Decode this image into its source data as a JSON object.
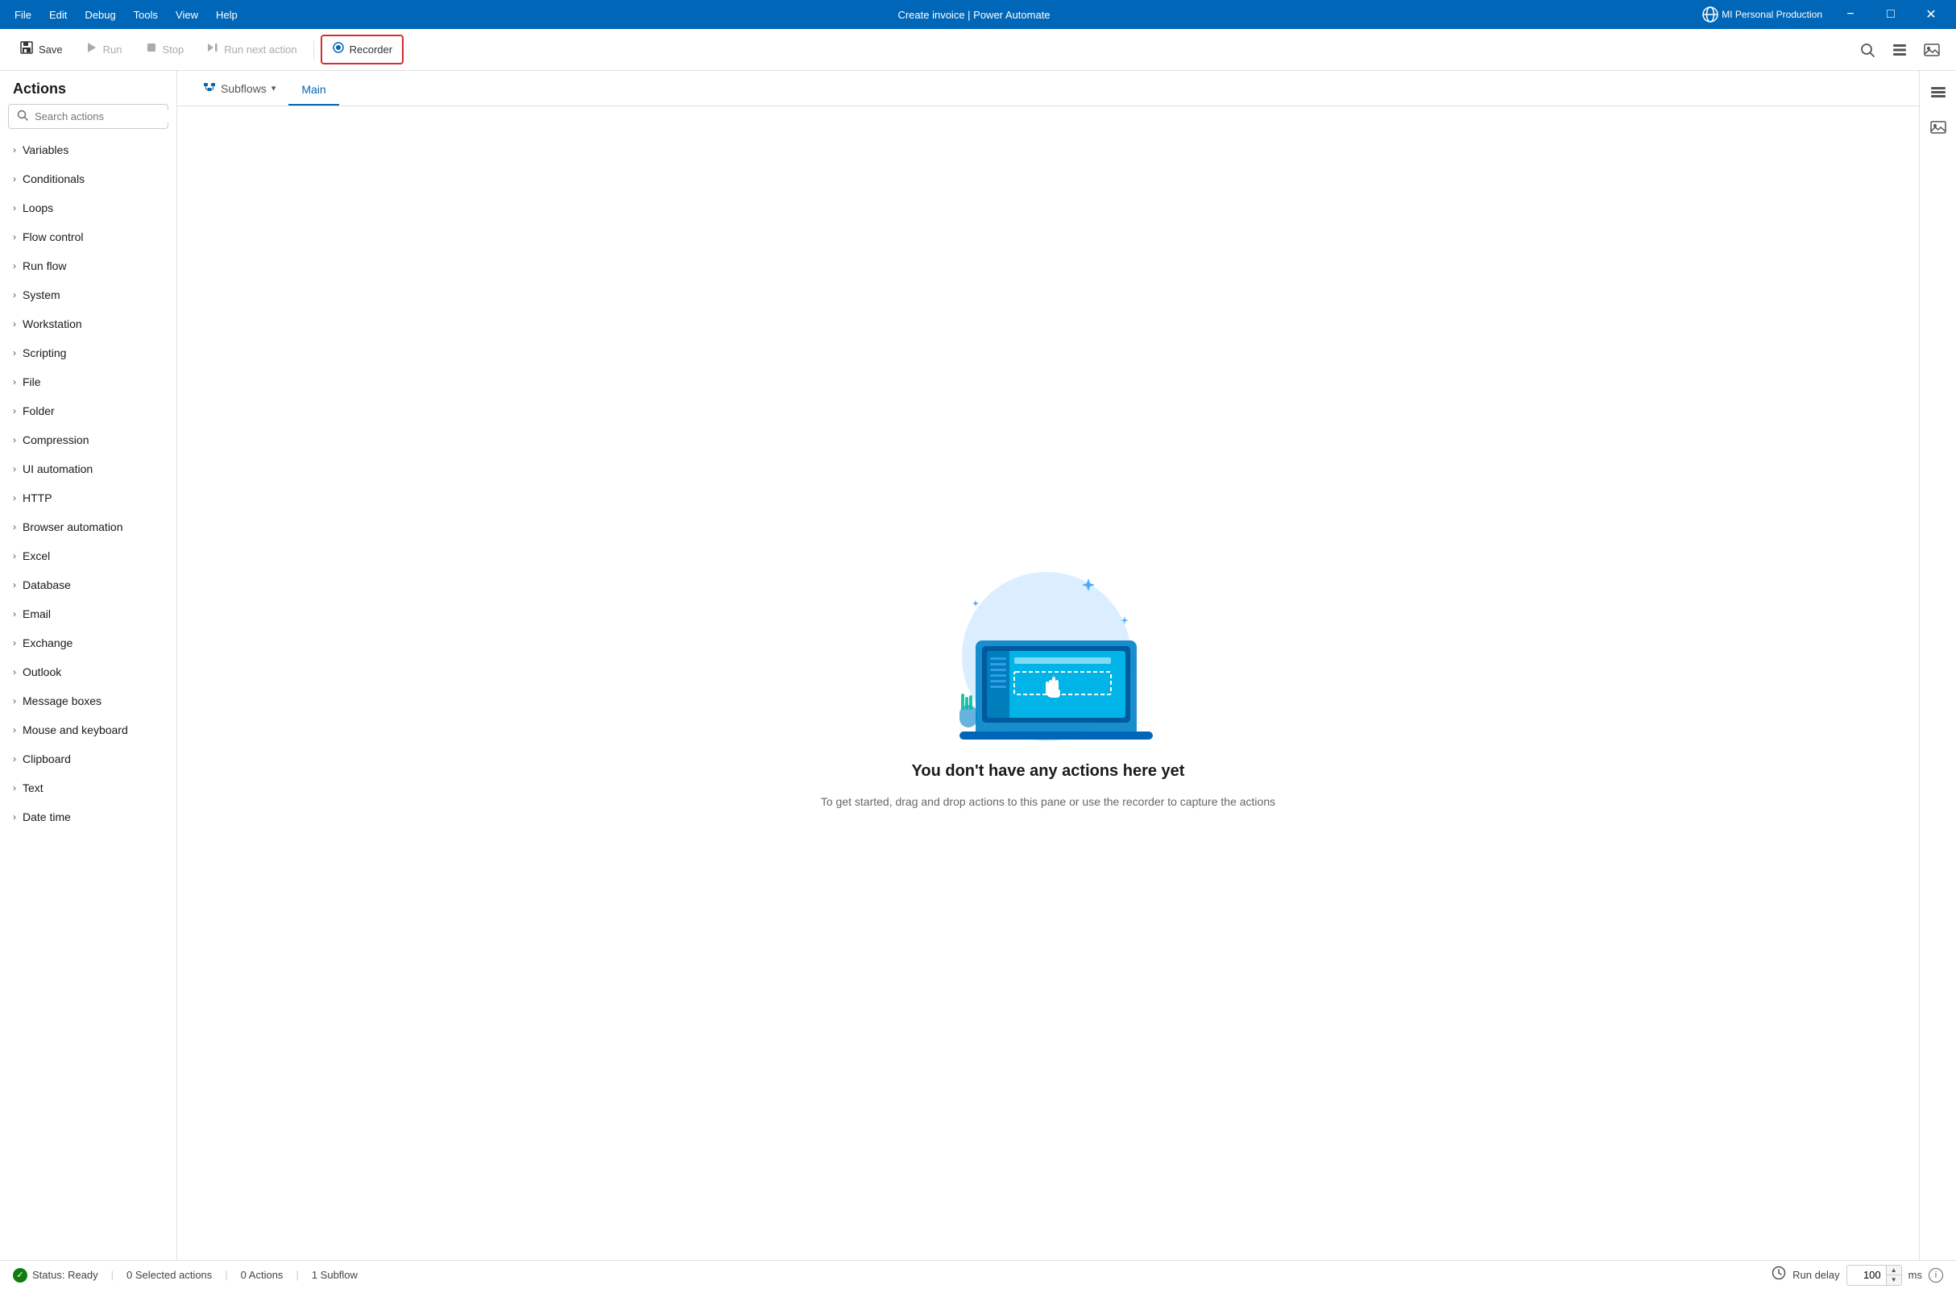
{
  "titleBar": {
    "menus": [
      "File",
      "Edit",
      "Debug",
      "Tools",
      "View",
      "Help"
    ],
    "title": "Create invoice | Power Automate",
    "account": "MI Personal Production",
    "minimizeLabel": "−",
    "maximizeLabel": "□",
    "closeLabel": "✕"
  },
  "toolbar": {
    "saveLabel": "Save",
    "runLabel": "Run",
    "stopLabel": "Stop",
    "runNextLabel": "Run next action",
    "recorderLabel": "Recorder",
    "searchPlaceholder": "Search actions"
  },
  "tabs": {
    "subflowsLabel": "Subflows",
    "mainLabel": "Main"
  },
  "actions": {
    "title": "Actions",
    "searchPlaceholder": "Search actions",
    "items": [
      "Variables",
      "Conditionals",
      "Loops",
      "Flow control",
      "Run flow",
      "System",
      "Workstation",
      "Scripting",
      "File",
      "Folder",
      "Compression",
      "UI automation",
      "HTTP",
      "Browser automation",
      "Excel",
      "Database",
      "Email",
      "Exchange",
      "Outlook",
      "Message boxes",
      "Mouse and keyboard",
      "Clipboard",
      "Text",
      "Date time"
    ]
  },
  "emptyState": {
    "title": "You don't have any actions here yet",
    "subtitle": "To get started, drag and drop actions to this pane\nor use the recorder to capture the actions"
  },
  "statusBar": {
    "status": "Status: Ready",
    "selectedActions": "0 Selected actions",
    "actionsCount": "0 Actions",
    "subflowCount": "1 Subflow",
    "runDelayLabel": "Run delay",
    "runDelayValue": "100",
    "runDelayUnit": "ms"
  }
}
